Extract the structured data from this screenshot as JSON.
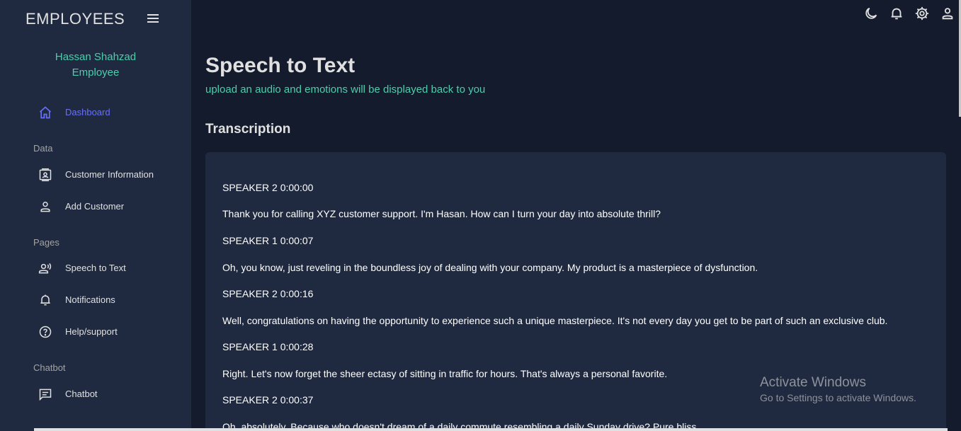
{
  "sidebar": {
    "brand": "EMPLOYEES",
    "user_name": "Hassan Shahzad",
    "user_role": "Employee",
    "items": [
      {
        "label": "Dashboard",
        "icon": "home-icon"
      },
      {
        "label": "Customer Information",
        "icon": "contacts-icon"
      },
      {
        "label": "Add Customer",
        "icon": "person-icon"
      },
      {
        "label": "Speech to Text",
        "icon": "record-voice-icon"
      },
      {
        "label": "Notifications",
        "icon": "bell-icon"
      },
      {
        "label": "Help/support",
        "icon": "help-icon"
      },
      {
        "label": "Chatbot",
        "icon": "chat-icon"
      }
    ],
    "sections": [
      "Data",
      "Pages",
      "Chatbot"
    ]
  },
  "topbar": {
    "icons": [
      "dark-mode-icon",
      "notifications-icon",
      "settings-icon",
      "profile-icon"
    ]
  },
  "main": {
    "title": "Speech to Text",
    "subtitle": "upload an audio and emotions will be displayed back to you",
    "section_title": "Transcription",
    "transcript": [
      "SPEAKER 2 0:00:00",
      "Thank you for calling XYZ customer support. I'm Hasan. How can I turn your day into absolute thrill?",
      "SPEAKER 1 0:00:07",
      "Oh, you know, just reveling in the boundless joy of dealing with your company. My product is a masterpiece of dysfunction.",
      "SPEAKER 2 0:00:16",
      "Well, congratulations on having the opportunity to experience such a unique masterpiece. It's not every day you get to be part of such an exclusive club.",
      "SPEAKER 1 0:00:28",
      "Right. Let's now forget the sheer ectasy of sitting in traffic for hours. That's always a personal favorite.",
      "SPEAKER 2 0:00:37",
      "Oh, absolutely. Because who doesn't dream of a daily commute resembling a daily Sunday drive? Pure bliss."
    ]
  },
  "watermark": {
    "title": "Activate Windows",
    "subtitle": "Go to Settings to activate Windows."
  },
  "colors": {
    "background": "#141b2d",
    "sidebar": "#1f2a40",
    "accent_green": "#4cceac",
    "accent_blue": "#6870fa"
  }
}
